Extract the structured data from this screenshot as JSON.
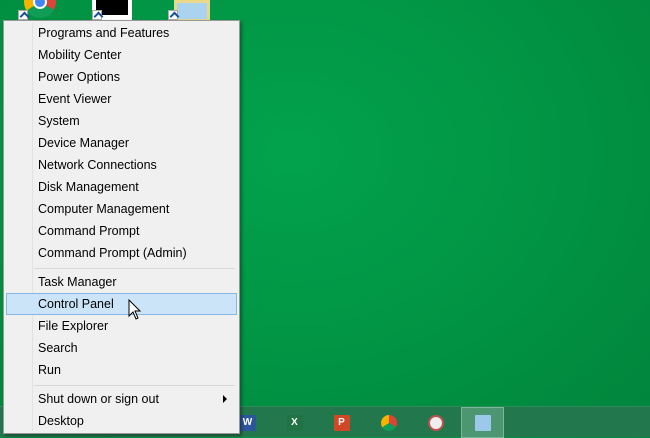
{
  "menu": {
    "group1": [
      "Programs and Features",
      "Mobility Center",
      "Power Options",
      "Event Viewer",
      "System",
      "Device Manager",
      "Network Connections",
      "Disk Management",
      "Computer Management",
      "Command Prompt",
      "Command Prompt (Admin)"
    ],
    "group2": [
      "Task Manager",
      "Control Panel",
      "File Explorer",
      "Search",
      "Run"
    ],
    "group3": [
      "Shut down or sign out",
      "Desktop"
    ],
    "highlighted": "Control Panel"
  },
  "taskbar": {
    "apps": [
      {
        "icon": "word-icon",
        "letter": "W",
        "color": "#2b579a"
      },
      {
        "icon": "excel-icon",
        "letter": "X",
        "color": "#217346"
      },
      {
        "icon": "powerpoint-icon",
        "letter": "P",
        "color": "#d24726"
      },
      {
        "icon": "chrome-icon",
        "letter": "",
        "color": "#4285f4"
      },
      {
        "icon": "snipping-tool-icon",
        "letter": "",
        "color": "#c0504d"
      },
      {
        "icon": "notepad-icon",
        "letter": "",
        "color": "#9cc9ea"
      }
    ]
  },
  "colors": {
    "desktop": "#019645",
    "highlight": "#cce4f7"
  }
}
